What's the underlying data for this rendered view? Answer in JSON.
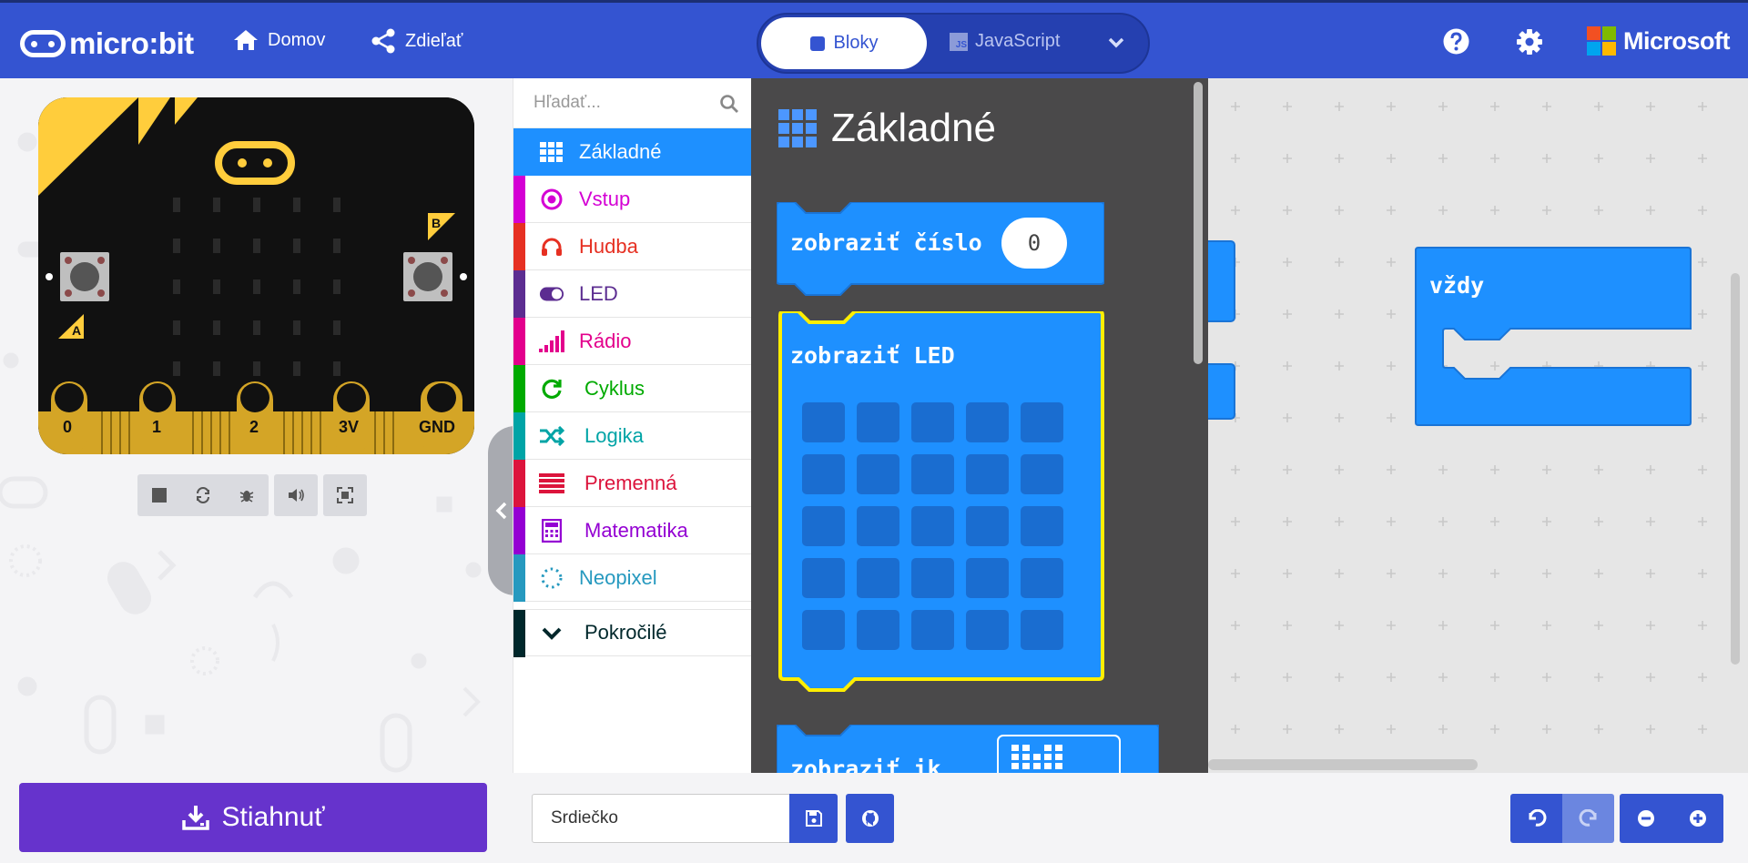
{
  "header": {
    "logo_text": "micro:bit",
    "home_label": "Domov",
    "share_label": "Zdieľať",
    "mode_blocks": "Bloky",
    "mode_js": "JavaScript",
    "js_badge": "JS",
    "brand": "Microsoft"
  },
  "simulator": {
    "pins": [
      "0",
      "1",
      "2",
      "3V",
      "GND"
    ],
    "button_a": "A",
    "button_b": "B",
    "controls": [
      "stop-icon",
      "restart-icon",
      "debug-icon",
      "sound-icon",
      "fullscreen-icon"
    ]
  },
  "toolbox": {
    "search_placeholder": "Hľadať...",
    "categories": [
      {
        "label": "Základné",
        "color": "#1e90ff",
        "icon": "grid-icon",
        "selected": true
      },
      {
        "label": "Vstup",
        "color": "#d400d4",
        "icon": "input-icon"
      },
      {
        "label": "Hudba",
        "color": "#e63022",
        "icon": "headphones-icon"
      },
      {
        "label": "LED",
        "color": "#5c2d91",
        "icon": "toggle-icon"
      },
      {
        "label": "Rádio",
        "color": "#e3008c",
        "icon": "signal-icon"
      },
      {
        "label": "Cyklus",
        "color": "#00aa00",
        "icon": "refresh-icon"
      },
      {
        "label": "Logika",
        "color": "#00a4a6",
        "icon": "shuffle-icon"
      },
      {
        "label": "Premenná",
        "color": "#dc143c",
        "icon": "lines-icon"
      },
      {
        "label": "Matematika",
        "color": "#9400d3",
        "icon": "calculator-icon"
      },
      {
        "label": "Neopixel",
        "color": "#2699bf",
        "icon": "dots-circle-icon"
      },
      {
        "label": "Pokročilé",
        "color": "#00272b",
        "icon": "chevron-down-icon"
      }
    ]
  },
  "flyout": {
    "title": "Základné",
    "block_show_number": "zobraziť číslo",
    "block_show_number_value": "0",
    "block_show_leds": "zobraziť LED",
    "block_show_icon_partial": "zobraziť ik"
  },
  "workspace": {
    "forever_label": "vždy"
  },
  "bottom": {
    "download_label": "Stiahnuť",
    "project_name": "Srdiečko"
  },
  "colors": {
    "header": "#3454d1",
    "download": "#6633cc",
    "block_basic": "#1e90ff",
    "flyout_bg": "#4a494a"
  }
}
